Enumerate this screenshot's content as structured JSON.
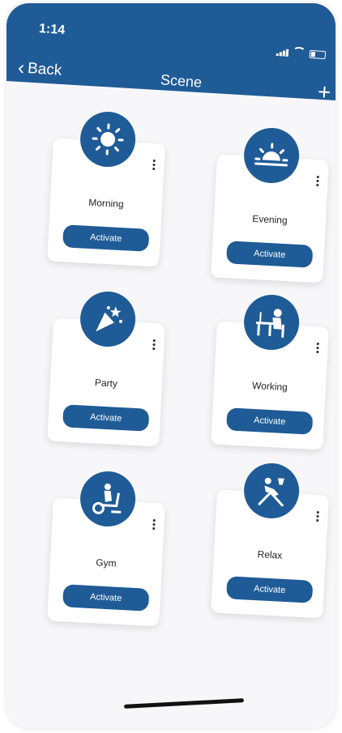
{
  "status_bar": {
    "time": "1:14"
  },
  "nav": {
    "back_label": "Back",
    "title": "Scene",
    "add_symbol": "+"
  },
  "scenes": [
    {
      "name": "Morning",
      "icon": "sun-icon",
      "action": "Activate"
    },
    {
      "name": "Evening",
      "icon": "sunset-icon",
      "action": "Activate"
    },
    {
      "name": "Party",
      "icon": "party-popper-icon",
      "action": "Activate"
    },
    {
      "name": "Working",
      "icon": "person-at-desk-icon",
      "action": "Activate"
    },
    {
      "name": "Gym",
      "icon": "exercise-bike-icon",
      "action": "Activate"
    },
    {
      "name": "Relax",
      "icon": "lounge-chair-icon",
      "action": "Activate"
    }
  ],
  "colors": {
    "primary": "#1f5b96",
    "background": "#f7f7f9",
    "card": "#ffffff"
  }
}
